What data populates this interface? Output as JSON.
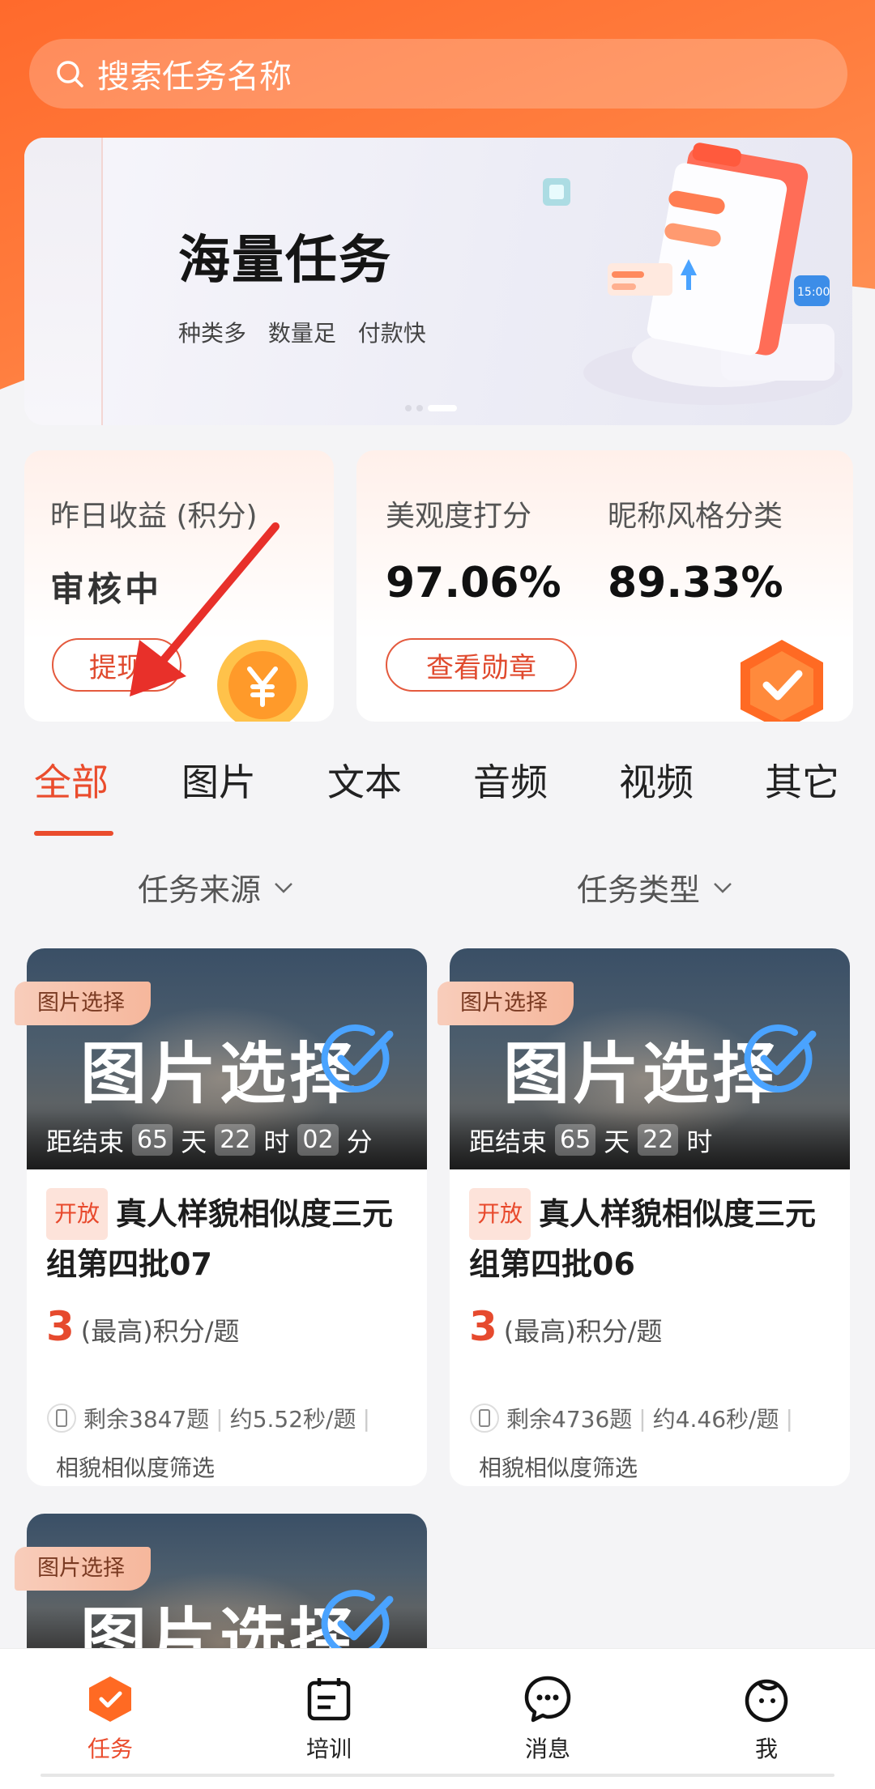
{
  "search": {
    "placeholder": "搜索任务名称"
  },
  "banner": {
    "title": "海量任务",
    "subtitle": "种类多 数量足 付款快",
    "clock_text": "15:00"
  },
  "earnings": {
    "label": "昨日收益 (积分)",
    "value": "审核中",
    "withdraw_label": "提现"
  },
  "scores": {
    "aesthetic_label": "美观度打分",
    "aesthetic_value": "97.06%",
    "nickname_label": "昵称风格分类",
    "nickname_value": "89.33%",
    "badge_button": "查看勋章"
  },
  "tabs": [
    "全部",
    "图片",
    "文本",
    "音频",
    "视频",
    "其它"
  ],
  "filters": {
    "source": "任务来源",
    "type": "任务类型"
  },
  "tasks": [
    {
      "ribbon": "图片选择",
      "cover_title": "图片选择",
      "countdown_prefix": "距结束",
      "days": "65",
      "day_unit": "天",
      "hours": "22",
      "hour_unit": "时",
      "minutes": "02",
      "minute_unit": "分",
      "status": "开放",
      "title": "真人样貌相似度三元组第四批07",
      "points": "3",
      "points_unit": "(最高)积分/题",
      "remaining": "剩余3847题",
      "speed": "约5.52秒/题",
      "tag": "相貌相似度筛选"
    },
    {
      "ribbon": "图片选择",
      "cover_title": "图片选择",
      "countdown_prefix": "距结束",
      "days": "65",
      "day_unit": "天",
      "hours": "22",
      "hour_unit": "时",
      "status": "开放",
      "title": "真人样貌相似度三元组第四批06",
      "points": "3",
      "points_unit": "(最高)积分/题",
      "remaining": "剩余4736题",
      "speed": "约4.46秒/题",
      "tag": "相貌相似度筛选"
    },
    {
      "ribbon": "图片选择",
      "cover_title": "图片选择"
    }
  ],
  "nav": {
    "task": "任务",
    "training": "培训",
    "message": "消息",
    "me": "我"
  },
  "colors": {
    "accent": "#ea4c2d",
    "header": "#ff6a2c"
  }
}
